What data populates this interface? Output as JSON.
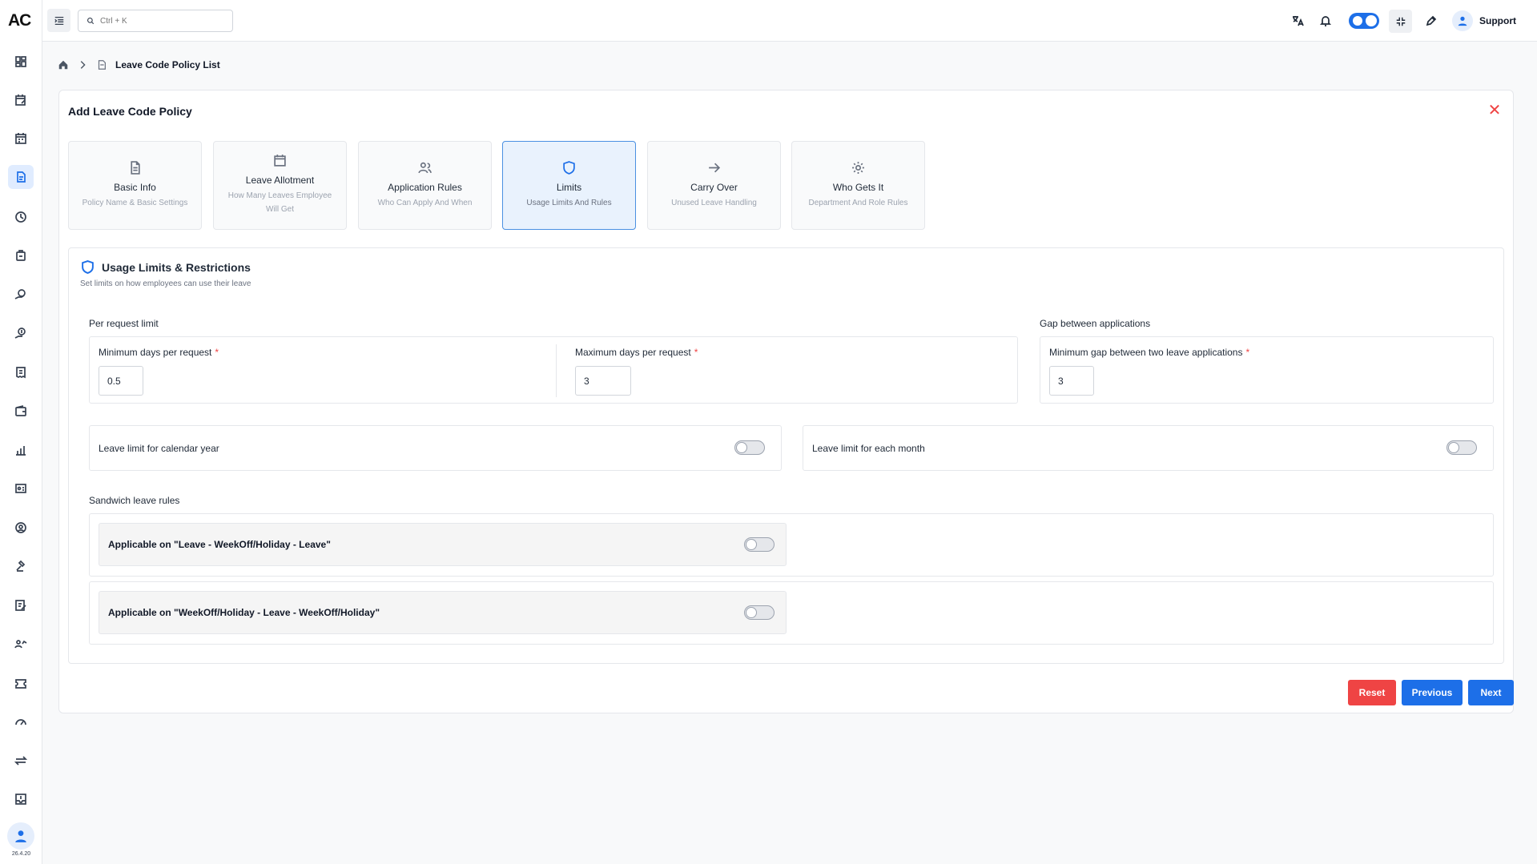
{
  "app": {
    "logo_text": "AC",
    "version": "26.4.20"
  },
  "search": {
    "placeholder": "Ctrl + K"
  },
  "topbar": {
    "user_name": "Support"
  },
  "sidebar": {
    "icons": [
      "dashboard-icon",
      "calendar-edit-icon",
      "calendar-icon",
      "leave-policy-icon",
      "clock-history-icon",
      "badge-icon",
      "hand-coin-icon",
      "money-hand-icon",
      "receipt-icon",
      "wallet-icon",
      "chart-people-icon",
      "id-card-icon",
      "user-circle-icon",
      "gavel-icon",
      "form-edit-icon",
      "team-growth-icon",
      "ticket-icon",
      "speed-edit-icon",
      "transfer-icon",
      "inbox-icon"
    ]
  },
  "breadcrumb": {
    "current": "Leave Code Policy List"
  },
  "card": {
    "title": "Add Leave Code Policy"
  },
  "steps": [
    {
      "title": "Basic Info",
      "subtitle": "Policy Name & Basic Settings",
      "icon": "document-icon"
    },
    {
      "title": "Leave Allotment",
      "subtitle": "How Many Leaves Employee Will Get",
      "icon": "calendar-icon"
    },
    {
      "title": "Application Rules",
      "subtitle": "Who Can Apply And When",
      "icon": "users-icon"
    },
    {
      "title": "Limits",
      "subtitle": "Usage Limits And Rules",
      "icon": "shield-icon",
      "active": true
    },
    {
      "title": "Carry Over",
      "subtitle": "Unused Leave Handling",
      "icon": "arrow-right-icon"
    },
    {
      "title": "Who Gets It",
      "subtitle": "Department And Role Rules",
      "icon": "gear-icon"
    }
  ],
  "section": {
    "title": "Usage Limits & Restrictions",
    "description": "Set limits on how employees can use their leave",
    "per_request": {
      "label": "Per request limit",
      "min_label": "Minimum days per request",
      "min_value": "0.5",
      "max_label": "Maximum days per request",
      "max_value": "3"
    },
    "gap": {
      "label": "Gap between applications",
      "min_gap_label": "Minimum gap between two leave applications",
      "min_gap_value": "3"
    },
    "required_marker": "*",
    "calendar_year_limit": {
      "label": "Leave limit for calendar year",
      "enabled": false
    },
    "monthly_limit": {
      "label": "Leave limit for each month",
      "enabled": false
    },
    "sandwich": {
      "label": "Sandwich leave rules",
      "rule1": {
        "label": "Applicable on \"Leave - WeekOff/Holiday - Leave\"",
        "enabled": false
      },
      "rule2": {
        "label": "Applicable on \"WeekOff/Holiday - Leave - WeekOff/Holiday\"",
        "enabled": false
      }
    }
  },
  "buttons": {
    "reset": "Reset",
    "previous": "Previous",
    "next": "Next"
  },
  "colors": {
    "primary": "#1d6fe8",
    "danger": "#ef4444",
    "active_step_bg": "#e9f2fd"
  }
}
